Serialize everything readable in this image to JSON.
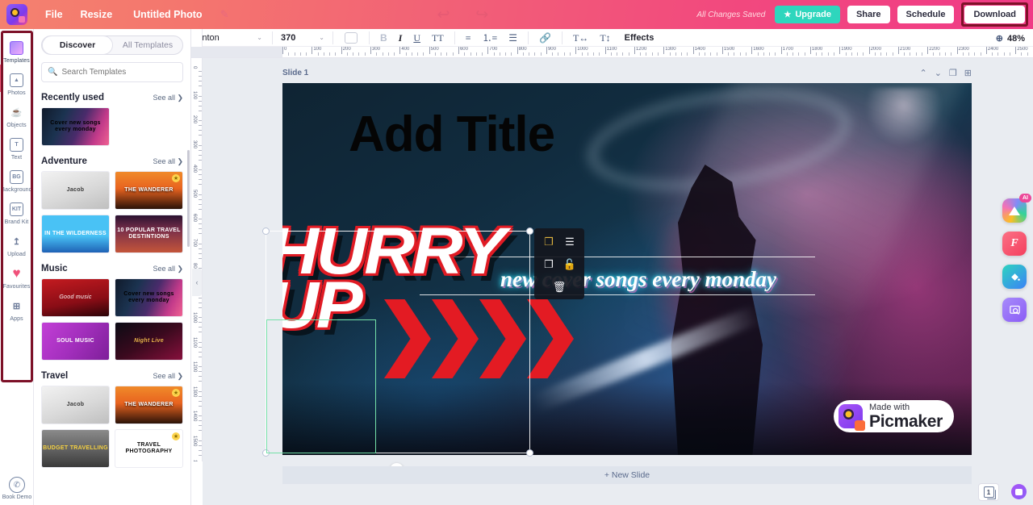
{
  "topbar": {
    "logo_icon": "picmaker-logo-icon",
    "menu_file": "File",
    "menu_resize": "Resize",
    "doc_title": "Untitled Photo",
    "pencil_icon": "pencil-icon",
    "undo_icon": "undo-arrow-icon",
    "redo_icon": "redo-arrow-icon",
    "saved_status": "All Changes Saved",
    "upgrade_label": "Upgrade",
    "upgrade_star": "★",
    "share_label": "Share",
    "schedule_label": "Schedule",
    "download_label": "Download",
    "accent_pink": "#f03a86",
    "accent_coral": "#f4816f",
    "upgrade_color": "#2ed6bd",
    "highlight_color": "#7d1128"
  },
  "rail": {
    "items": [
      {
        "label": "Templates",
        "icon": "templates-icon"
      },
      {
        "label": "Photos",
        "icon": "photos-icon"
      },
      {
        "label": "Objects",
        "icon": "objects-icon"
      },
      {
        "label": "Text",
        "icon": "text-icon"
      },
      {
        "label": "Background",
        "icon": "background-icon"
      },
      {
        "label": "Brand Kit",
        "icon": "brandkit-icon"
      },
      {
        "label": "Upload",
        "icon": "upload-icon"
      },
      {
        "label": "Favourites",
        "icon": "heart-icon"
      },
      {
        "label": "Apps",
        "icon": "apps-icon"
      }
    ],
    "icon_glyphs": [
      "▣",
      "🖼",
      "☕",
      "T",
      "BG",
      "KIT",
      "↥",
      "♥",
      "⊞"
    ],
    "book_demo": "Book Demo",
    "book_demo_icon": "phone-icon"
  },
  "panel": {
    "tabs": [
      {
        "label": "Discover",
        "active": true
      },
      {
        "label": "All Templates",
        "active": false
      }
    ],
    "search_placeholder": "Search Templates",
    "search_icon": "search-icon",
    "see_all": "See all",
    "sections": [
      {
        "title": "Recently used",
        "items": [
          {
            "label": "Cover new songs every monday",
            "theme": "t-concert",
            "star": false
          }
        ]
      },
      {
        "title": "Adventure",
        "items": [
          {
            "label": "Jacob",
            "theme": "t-jacob",
            "star": false
          },
          {
            "label": "THE WANDERER",
            "theme": "t-wanderer",
            "star": true
          },
          {
            "label": "IN THE WILDERNESS",
            "theme": "t-wild",
            "star": false
          },
          {
            "label": "10 POPULAR TRAVEL DESTINTIONS",
            "theme": "t-city",
            "star": false
          }
        ]
      },
      {
        "title": "Music",
        "items": [
          {
            "label": "Good music",
            "theme": "t-good",
            "star": false
          },
          {
            "label": "Cover new songs every monday",
            "theme": "t-concert",
            "star": false
          },
          {
            "label": "SOUL MUSIC",
            "theme": "t-soul",
            "star": false
          },
          {
            "label": "Night Live",
            "theme": "t-night",
            "star": false
          }
        ]
      },
      {
        "title": "Travel",
        "items": [
          {
            "label": "Jacob",
            "theme": "t-jacob",
            "star": false
          },
          {
            "label": "THE WANDERER",
            "theme": "t-wanderer",
            "star": true
          },
          {
            "label": "BUDGET TRAVELLING",
            "theme": "t-budget",
            "star": false
          },
          {
            "label": "TRAVEL PHOTOGRAPHY",
            "theme": "t-photo",
            "star": true
          }
        ]
      }
    ]
  },
  "toolbar": {
    "font_family_value": "Anton",
    "font_size_value": "370",
    "chevron": "⌄",
    "color_swatch": "#ffffff",
    "bold": "B",
    "italic": "I",
    "underline": "U",
    "uppercase": "TT",
    "align": "≡",
    "ordered_list": "⒈≡",
    "bullet_list": "☰",
    "link": "🔗",
    "letter_spacing": "T↔",
    "line_height": "T↕",
    "effects_label": "Effects",
    "zoom_icon": "magnifier-icon",
    "zoom_value": "48%"
  },
  "rulers": {
    "h_ticks": [
      0,
      100,
      200,
      300,
      400,
      500,
      600,
      700,
      800,
      900,
      1000,
      1100,
      1200,
      1300,
      1400,
      1500,
      1600,
      1700,
      1800,
      1900,
      2000,
      2100,
      2200,
      2300,
      2400,
      2500
    ],
    "v_ticks": [
      0,
      100,
      200,
      300,
      400,
      500,
      600,
      700,
      800,
      900,
      1000,
      1100,
      1200,
      1300,
      1400,
      1500,
      1600
    ],
    "collapse_icon": "chevron-left-icon"
  },
  "canvas": {
    "slide_label": "Slide 1",
    "slide_actions": [
      "move-up-icon",
      "move-down-icon",
      "duplicate-slide-icon",
      "add-slide-icon"
    ],
    "slide_action_glyphs": [
      "⌃",
      "⌄",
      "❐",
      "⊞"
    ],
    "new_slide_label": "+ New Slide",
    "rotate_icon": "rotate-handle-icon",
    "artwork": {
      "title_text": "Add Title",
      "headline_line1": "HURRY",
      "headline_line2": "UP",
      "subtitle_text": "new cover songs every monday",
      "headline_color": "#ffffff",
      "headline_outline": "#e01b24",
      "chevron_color": "#e31b23",
      "subtitle_glow": "#34e3f0"
    },
    "watermark": {
      "line1": "Made with",
      "line2": "Picmaker",
      "icon": "picmaker-logo-icon"
    },
    "context_menu": {
      "items": [
        {
          "icon": "group-icon",
          "glyph": "❐",
          "gold": true
        },
        {
          "icon": "layers-icon",
          "glyph": "☰"
        },
        {
          "icon": "duplicate-icon",
          "glyph": "❐"
        },
        {
          "icon": "unlock-icon",
          "glyph": "🔓"
        },
        {
          "icon": "delete-icon",
          "glyph": "🗑"
        }
      ]
    }
  },
  "right_tools": {
    "buttons": [
      {
        "name": "ai-image-button",
        "badge": "AI"
      },
      {
        "name": "font-tool-button",
        "glyph": "F"
      },
      {
        "name": "color-fill-button",
        "glyph": "⬧"
      },
      {
        "name": "image-search-button",
        "glyph": "⌕"
      }
    ],
    "slide_count": "1",
    "chat_icon": "chat-bubble-icon"
  }
}
